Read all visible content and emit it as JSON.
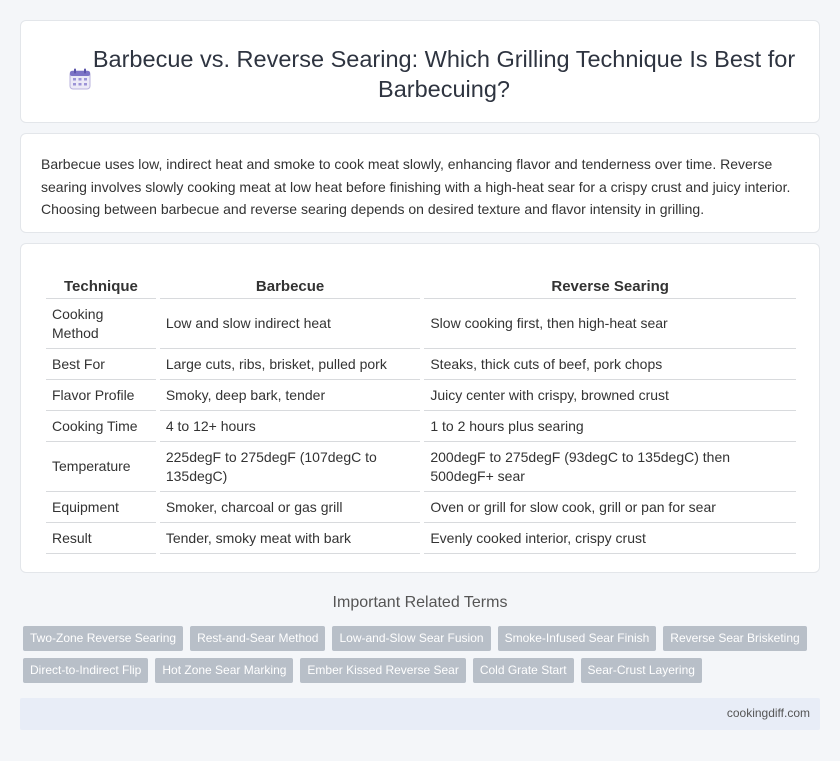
{
  "header": {
    "title": "Barbecue vs. Reverse Searing: Which Grilling Technique Is Best for Barbecuing?",
    "icon": "calendar-icon"
  },
  "intro": {
    "text": "Barbecue uses low, indirect heat and smoke to cook meat slowly, enhancing flavor and tenderness over time. Reverse searing involves slowly cooking meat at low heat before finishing with a high-heat sear for a crispy crust and juicy interior. Choosing between barbecue and reverse searing depends on desired texture and flavor intensity in grilling."
  },
  "table": {
    "headers": [
      "Technique",
      "Barbecue",
      "Reverse Searing"
    ],
    "rows": [
      [
        "Cooking Method",
        "Low and slow indirect heat",
        "Slow cooking first, then high-heat sear"
      ],
      [
        "Best For",
        "Large cuts, ribs, brisket, pulled pork",
        "Steaks, thick cuts of beef, pork chops"
      ],
      [
        "Flavor Profile",
        "Smoky, deep bark, tender",
        "Juicy center with crispy, browned crust"
      ],
      [
        "Cooking Time",
        "4 to 12+ hours",
        "1 to 2 hours plus searing"
      ],
      [
        "Temperature",
        "225degF to 275degF (107degC to 135degC)",
        "200degF to 275degF (93degC to 135degC) then 500degF+ sear"
      ],
      [
        "Equipment",
        "Smoker, charcoal or gas grill",
        "Oven or grill for slow cook, grill or pan for sear"
      ],
      [
        "Result",
        "Tender, smoky meat with bark",
        "Evenly cooked interior, crispy crust"
      ]
    ]
  },
  "related": {
    "title": "Important Related Terms",
    "tags": [
      "Two-Zone Reverse Searing",
      "Rest-and-Sear Method",
      "Low-and-Slow Sear Fusion",
      "Smoke-Infused Sear Finish",
      "Reverse Sear Brisketing",
      "Direct-to-Indirect Flip",
      "Hot Zone Sear Marking",
      "Ember Kissed Reverse Sear",
      "Cold Grate Start",
      "Sear-Crust Layering"
    ]
  },
  "footer": {
    "site": "cookingdiff.com"
  }
}
